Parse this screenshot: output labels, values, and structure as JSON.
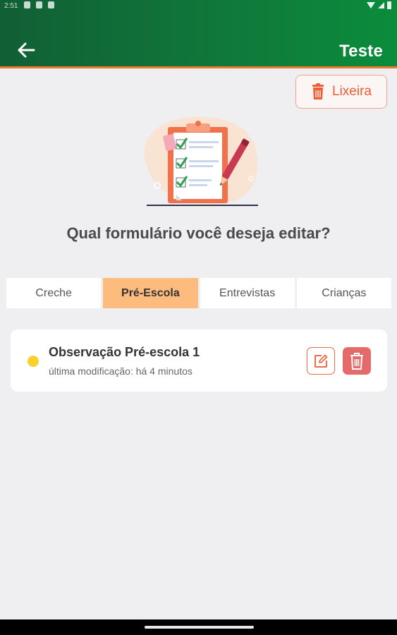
{
  "status_bar": {
    "time": "2:51",
    "icons": [
      "location-icon",
      "sd-card-icon",
      "settings-icon",
      "wifi-icon",
      "signal-icon",
      "battery-icon"
    ]
  },
  "app_bar": {
    "back_icon": "arrow-back-icon",
    "title": "Teste"
  },
  "trash_button": {
    "label": "Lixeira",
    "icon": "trash-icon"
  },
  "question": "Qual formulário você deseja editar?",
  "tabs": [
    {
      "label": "Creche",
      "active": false
    },
    {
      "label": "Pré-Escola",
      "active": true
    },
    {
      "label": "Entrevistas",
      "active": false
    },
    {
      "label": "Crianças",
      "active": false
    }
  ],
  "form_card": {
    "title": "Observação Pré-escola 1",
    "subtitle": "última modificação: há 4 minutos",
    "status_color": "#fcd02a",
    "edit_icon": "edit-icon",
    "delete_icon": "trash-icon"
  },
  "colors": {
    "appbar_green": "#0f7a3a",
    "accent_orange": "#ec7a2c",
    "tab_active": "#fdbb7d",
    "delete_red": "#e56b6b"
  }
}
